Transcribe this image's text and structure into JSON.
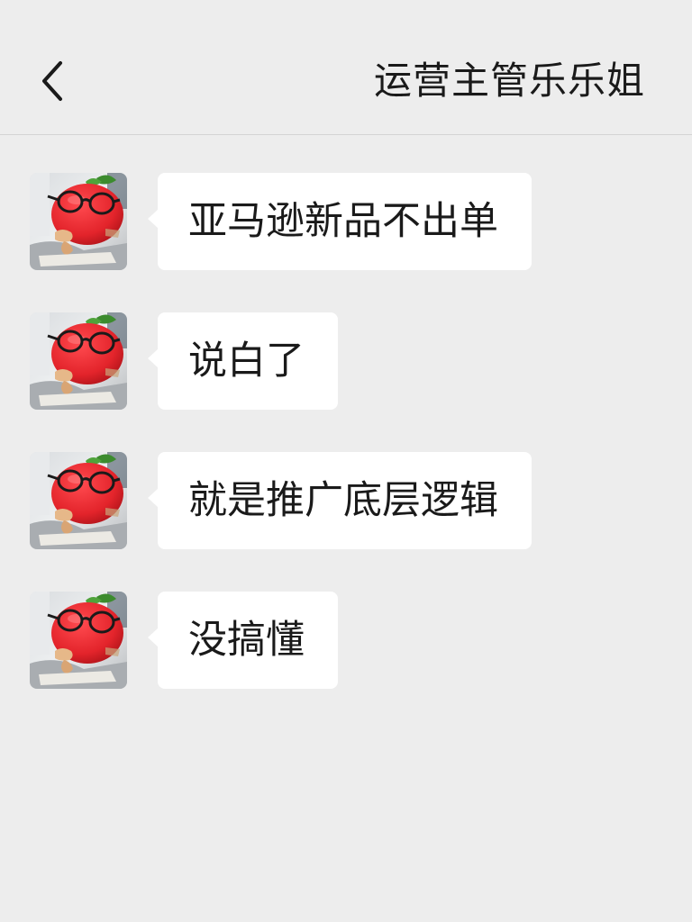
{
  "header": {
    "back_icon": "chevron-left-icon",
    "title": "运营主管乐乐姐"
  },
  "messages": [
    {
      "avatar_icon": "tomato-avatar",
      "text": "亚马逊新品不出单"
    },
    {
      "avatar_icon": "tomato-avatar",
      "text": "说白了"
    },
    {
      "avatar_icon": "tomato-avatar",
      "text": "就是推广底层逻辑"
    },
    {
      "avatar_icon": "tomato-avatar",
      "text": "没搞懂"
    }
  ],
  "colors": {
    "background": "#ededed",
    "bubble": "#ffffff",
    "text": "#1a1a1a",
    "avatar_tomato": "#e3242b"
  }
}
